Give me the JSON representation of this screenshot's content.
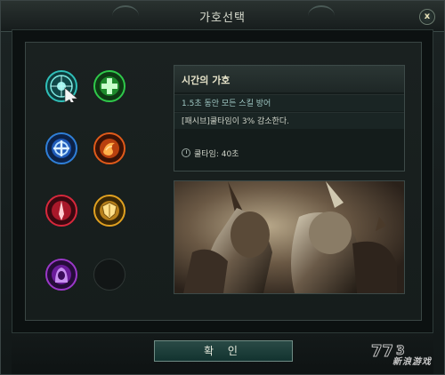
{
  "window": {
    "title": "가호선택",
    "close_label": "x"
  },
  "skills": [
    {
      "name": "time-blessing-icon",
      "color": "#2fbfb8",
      "selected": true
    },
    {
      "name": "heal-cross-icon",
      "color": "#2fc84a"
    },
    {
      "name": "blue-cross-icon",
      "color": "#2f7fd8"
    },
    {
      "name": "flame-swirl-icon",
      "color": "#e05a1a"
    },
    {
      "name": "red-blade-icon",
      "color": "#d8283c"
    },
    {
      "name": "gold-shield-icon",
      "color": "#e0a020"
    },
    {
      "name": "purple-hood-icon",
      "color": "#9a38c8"
    },
    {
      "name": "empty-slot"
    }
  ],
  "info": {
    "title": "시간의 가호",
    "line1": "1.5초 동안 모든 스킬 방어",
    "line2": "[패시브]쿨타임이 3% 감소한다.",
    "cooldown": "쿨타임: 40초"
  },
  "footer": {
    "confirm_label": "확 인"
  },
  "watermark": {
    "text": "新浪游戏"
  }
}
